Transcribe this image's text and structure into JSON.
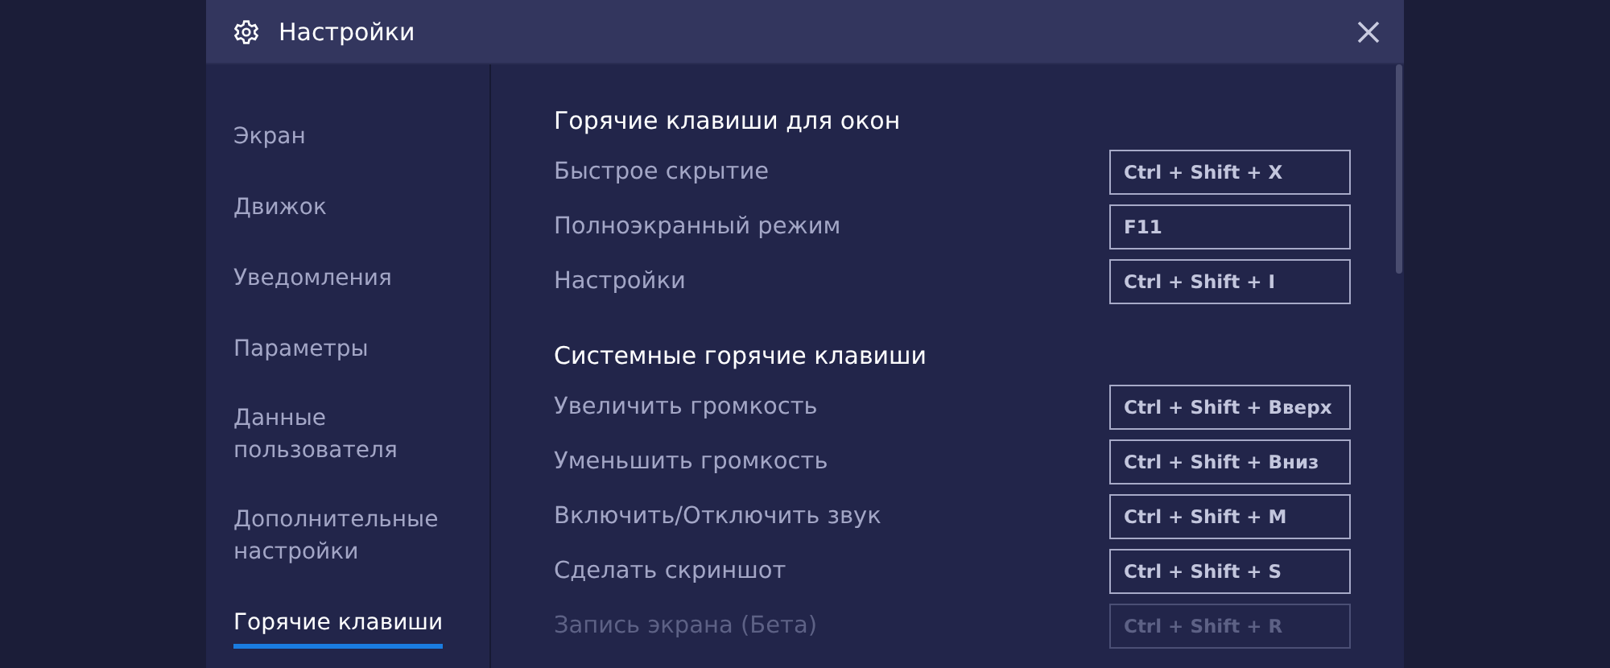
{
  "window": {
    "title": "Настройки"
  },
  "sidebar": {
    "items": [
      {
        "label": "Экран",
        "selected": false
      },
      {
        "label": "Движок",
        "selected": false
      },
      {
        "label": "Уведомления",
        "selected": false
      },
      {
        "label": "Параметры",
        "selected": false
      },
      {
        "label": "Данные пользователя",
        "selected": false
      },
      {
        "label": "Дополнительные настройки",
        "selected": false
      },
      {
        "label": "Горячие клавиши",
        "selected": true
      }
    ]
  },
  "sections": [
    {
      "title": "Горячие клавиши для окон",
      "rows": [
        {
          "label": "Быстрое скрытие",
          "shortcut": "Ctrl + Shift + X",
          "disabled": false
        },
        {
          "label": "Полноэкранный режим",
          "shortcut": "F11",
          "disabled": false
        },
        {
          "label": "Настройки",
          "shortcut": "Ctrl + Shift + I",
          "disabled": false
        }
      ]
    },
    {
      "title": "Системные горячие клавиши",
      "rows": [
        {
          "label": "Увеличить громкость",
          "shortcut": "Ctrl + Shift + Вверх",
          "disabled": false
        },
        {
          "label": "Уменьшить громкость",
          "shortcut": "Ctrl + Shift + Вниз",
          "disabled": false
        },
        {
          "label": "Включить/Отключить звук",
          "shortcut": "Ctrl + Shift + M",
          "disabled": false
        },
        {
          "label": "Сделать скриншот",
          "shortcut": "Ctrl + Shift + S",
          "disabled": false
        },
        {
          "label": "Запись экрана (Бета)",
          "shortcut": "Ctrl + Shift + R",
          "disabled": true
        }
      ]
    }
  ]
}
